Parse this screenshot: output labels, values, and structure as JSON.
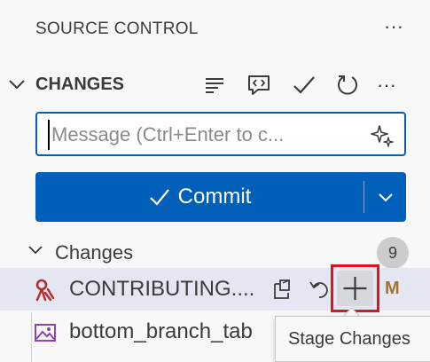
{
  "header": {
    "title": "SOURCE CONTROL",
    "more_label": "···"
  },
  "changes_section": {
    "title": "CHANGES",
    "toolbar_icons": [
      "view-as-tree-icon",
      "commit-chat-icon",
      "commit-check-icon",
      "refresh-icon",
      "more-actions-icon"
    ],
    "more_label": "···"
  },
  "message": {
    "placeholder": "Message (Ctrl+Enter to c...",
    "value": ""
  },
  "commit": {
    "label": "Commit"
  },
  "tree": {
    "label": "Changes",
    "count": "9"
  },
  "files": [
    {
      "name": "CONTRIBUTING....",
      "status": "M",
      "icon": "git-file-icon"
    },
    {
      "name": "bottom_branch_tab",
      "icon": "image-file-icon"
    }
  ],
  "tooltip": {
    "text": "Stage Changes"
  },
  "colors": {
    "accent": "#005fb8",
    "highlight_border": "#e0141e",
    "modified_status": "#a8722a",
    "selected_row": "#e4e6f1"
  }
}
